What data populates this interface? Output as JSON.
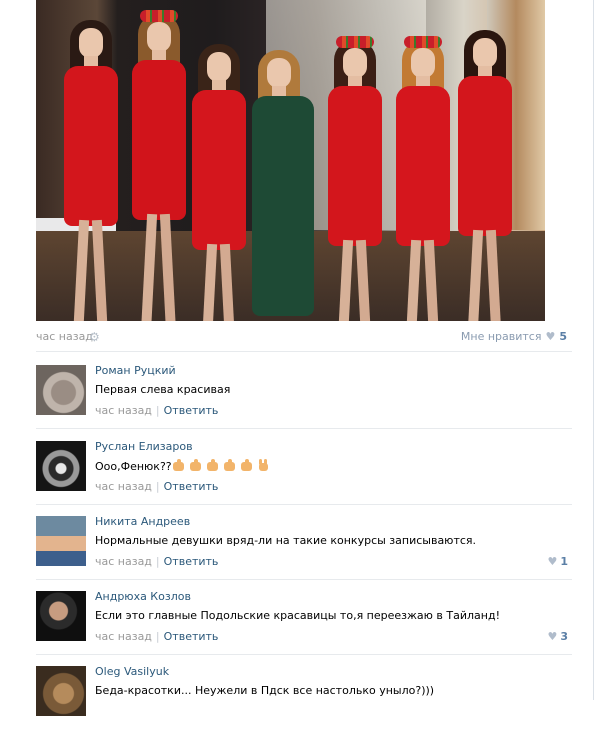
{
  "post": {
    "time": "час назад",
    "like_label": "Мне нравится",
    "like_count": "5"
  },
  "comments": [
    {
      "author": "Роман Руцкий",
      "text": "Первая слева красивая",
      "time": "час назад",
      "reply": "Ответить",
      "likes": null
    },
    {
      "author": "Руслан Елизаров",
      "text": "Ооо,Фенюк??",
      "emoji": [
        "thumbs-up",
        "thumbs-up",
        "thumbs-up",
        "thumbs-up",
        "thumbs-up",
        "victory-hand"
      ],
      "time": "час назад",
      "reply": "Ответить",
      "likes": null
    },
    {
      "author": "Никита Андреев",
      "text": "Нормальные девушки вряд-ли на такие конкурсы записываются.",
      "time": "час назад",
      "reply": "Ответить",
      "likes": "1"
    },
    {
      "author": "Андрюха Козлов",
      "text": "Если это главные Подольские красавицы то,я переезжаю в Тайланд!",
      "time": "час назад",
      "reply": "Ответить",
      "likes": "3"
    },
    {
      "author": "Oleg Vasilyuk",
      "text": "Беда-красотки... Неужели в Пдск все настолько уныло?)))",
      "time": "час назад",
      "reply": "Ответить",
      "likes": null
    }
  ],
  "colors": {
    "link": "#2b587a",
    "muted": "#999999",
    "like_count": "#5b7fa6"
  }
}
